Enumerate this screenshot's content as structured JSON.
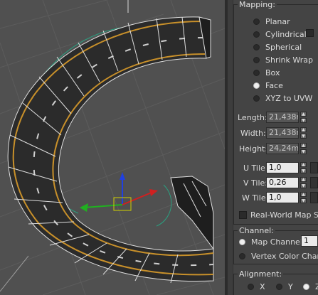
{
  "mapping": {
    "title": "Mapping:",
    "options": [
      {
        "label": "Planar",
        "selected": false
      },
      {
        "label": "Cylindrical",
        "selected": false
      },
      {
        "label": "Spherical",
        "selected": false
      },
      {
        "label": "Shrink Wrap",
        "selected": false
      },
      {
        "label": "Box",
        "selected": false
      },
      {
        "label": "Face",
        "selected": true
      },
      {
        "label": "XYZ to UVW",
        "selected": false
      }
    ],
    "length_label": "Length:",
    "length_value": "21,438m",
    "width_label": "Width:",
    "width_value": "21,438m",
    "height_label": "Height:",
    "height_value": "24,24m",
    "utile_label": "U Tile:",
    "utile_value": "1,0",
    "vtile_label": "V Tile:",
    "vtile_value": "0,26",
    "wtile_label": "W Tile:",
    "wtile_value": "1,0",
    "realworld_label": "Real-World Map Size"
  },
  "channel": {
    "title": "Channel:",
    "map_channel_label": "Map Channel:",
    "map_channel_value": "1",
    "vertex_color_label": "Vertex Color Channel",
    "map_channel_selected": true
  },
  "alignment": {
    "title": "Alignment:",
    "axes": [
      "X",
      "Y",
      "Z"
    ],
    "selected_axis": "Z"
  },
  "colors": {
    "viewport_bg": "#505050",
    "panel_bg": "#444444",
    "road_surface": "#2a2a2a",
    "road_edge_stripe": "#c8902a",
    "gizmo_x": "#d02020",
    "gizmo_y": "#20b020",
    "gizmo_z": "#2040e0",
    "uvw_gizmo": "#2aa080"
  }
}
